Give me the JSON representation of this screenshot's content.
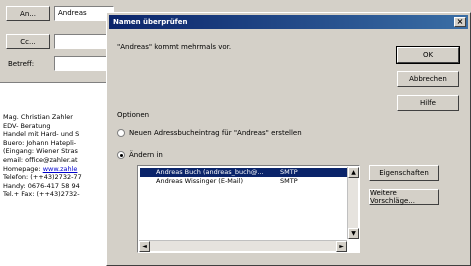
{
  "compose": {
    "to_button": "An...",
    "to_value": "Andreas",
    "cc_button": "Cc...",
    "cc_value": "",
    "subject_label": "Betreff:",
    "subject_value": "",
    "signature_lines": [
      "Mag. Christian Zahler",
      "EDV- Beratung",
      "Handel mit Hard- und S",
      "Buero: Johann Hatepli-",
      "(Eingang: Wiener Stras",
      "email: office@zahler.at",
      "Homepage: www.zahle",
      "Telefon: (++43)2732-77",
      "Handy: 0676-417 58 94",
      "Tel.+ Fax: (++43)2732-"
    ],
    "homepage_label": "Homepage: ",
    "homepage_link": "www.zahle"
  },
  "dialog": {
    "title": "Namen überprüfen",
    "close_glyph": "×",
    "message": "\"Andreas\" kommt mehrmals vor.",
    "buttons": {
      "ok": "OK",
      "cancel": "Abbrechen",
      "help": "Hilfe",
      "properties": "Eigenschaften",
      "more_names": "Weitere Vorschläge..."
    },
    "options_label": "Optionen",
    "option_create": "Neuen Adressbucheintrag für \"Andreas\" erstellen",
    "option_change": "Ändern in",
    "list": [
      {
        "name": "Andreas Buch (andreas_buch@...",
        "type": "SMTP",
        "selected": true
      },
      {
        "name": "Andreas Wissinger (E-Mail)",
        "type": "SMTP",
        "selected": false
      }
    ],
    "scroll_glyphs": {
      "up": "▲",
      "down": "▼",
      "left": "◄",
      "right": "►"
    }
  }
}
